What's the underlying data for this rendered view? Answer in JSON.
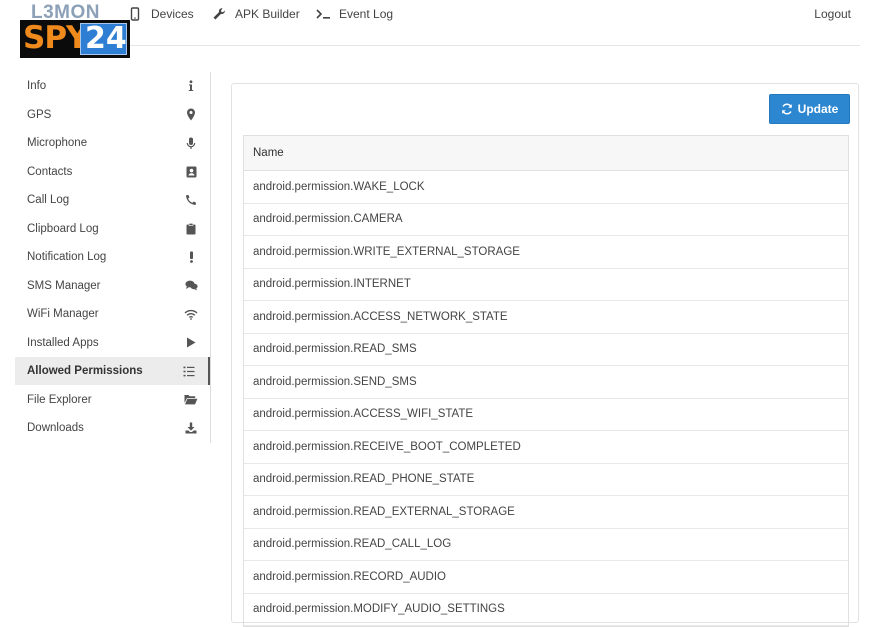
{
  "brand": {
    "title": "L3MON",
    "logo_spy": "SPY",
    "logo_num": "24"
  },
  "nav": {
    "devices": "Devices",
    "apk_builder": "APK Builder",
    "event_log": "Event Log",
    "logout": "Logout"
  },
  "sidebar": {
    "items": [
      {
        "label": "Info",
        "icon": "info-icon"
      },
      {
        "label": "GPS",
        "icon": "map-marker-icon"
      },
      {
        "label": "Microphone",
        "icon": "microphone-icon"
      },
      {
        "label": "Contacts",
        "icon": "address-book-icon"
      },
      {
        "label": "Call Log",
        "icon": "phone-icon"
      },
      {
        "label": "Clipboard Log",
        "icon": "clipboard-icon"
      },
      {
        "label": "Notification Log",
        "icon": "exclamation-icon"
      },
      {
        "label": "SMS Manager",
        "icon": "chat-bubbles-icon"
      },
      {
        "label": "WiFi Manager",
        "icon": "wifi-icon"
      },
      {
        "label": "Installed Apps",
        "icon": "play-icon"
      },
      {
        "label": "Allowed Permissions",
        "icon": "list-icon"
      },
      {
        "label": "File Explorer",
        "icon": "folder-open-icon"
      },
      {
        "label": "Downloads",
        "icon": "download-icon"
      }
    ],
    "active_index": 10
  },
  "main": {
    "update_label": "Update",
    "table": {
      "header": "Name",
      "rows": [
        "android.permission.WAKE_LOCK",
        "android.permission.CAMERA",
        "android.permission.WRITE_EXTERNAL_STORAGE",
        "android.permission.INTERNET",
        "android.permission.ACCESS_NETWORK_STATE",
        "android.permission.READ_SMS",
        "android.permission.SEND_SMS",
        "android.permission.ACCESS_WIFI_STATE",
        "android.permission.RECEIVE_BOOT_COMPLETED",
        "android.permission.READ_PHONE_STATE",
        "android.permission.READ_EXTERNAL_STORAGE",
        "android.permission.READ_CALL_LOG",
        "android.permission.RECORD_AUDIO",
        "android.permission.MODIFY_AUDIO_SETTINGS"
      ]
    }
  },
  "colors": {
    "accent": "#2c87d0",
    "logo_orange": "#f08a1c",
    "logo_blue": "#2e7fd3"
  }
}
